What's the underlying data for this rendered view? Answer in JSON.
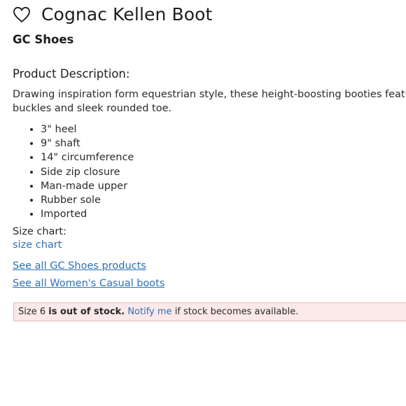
{
  "product": {
    "title": "Cognac Kellen Boot",
    "brand": "GC Shoes"
  },
  "icons": {
    "wishlist": "heart-outline-icon"
  },
  "description": {
    "heading": "Product Description:",
    "line1": "Drawing inspiration form equestrian style, these height-boosting booties feature a d",
    "line2": "buckles and sleek rounded toe."
  },
  "features": [
    "3\" heel",
    "9\" shaft",
    "14\" circumference",
    "Side zip closure",
    "Man-made upper",
    "Rubber sole",
    "Imported"
  ],
  "size_chart": {
    "label": "Size chart:",
    "link_text": "size chart"
  },
  "links": {
    "brand_products": "See all GC Shoes products",
    "category": "See all Women's Casual boots"
  },
  "stock_notice": {
    "size_text": "Size 6",
    "status": "is out of stock.",
    "notify_label": "Notify me",
    "suffix": "if stock becomes available."
  },
  "colors": {
    "link": "#2e6fb5",
    "notice_background": "#fbe8e8",
    "notice_border": "#e4bcbc"
  }
}
